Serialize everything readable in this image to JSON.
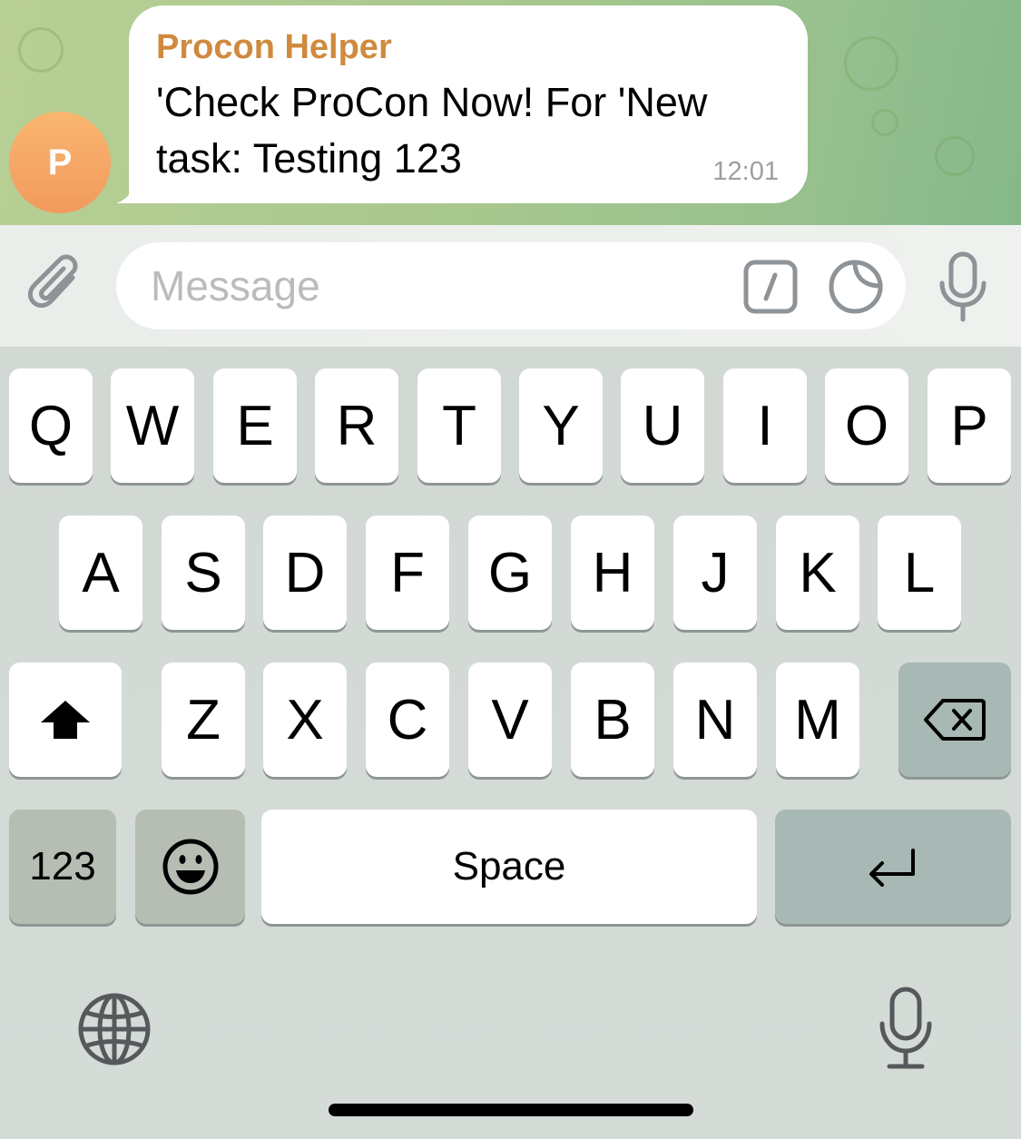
{
  "chat": {
    "avatar_letter": "P",
    "message": {
      "sender": "Procon Helper",
      "text": "'Check ProCon Now! For 'New task: Testing 123",
      "time": "12:01"
    }
  },
  "composer": {
    "placeholder": "Message",
    "icons": [
      "paperclip-icon",
      "slash-command-icon",
      "sticker-icon",
      "microphone-icon"
    ]
  },
  "keyboard": {
    "row1": [
      "Q",
      "W",
      "E",
      "R",
      "T",
      "Y",
      "U",
      "I",
      "O",
      "P"
    ],
    "row2": [
      "A",
      "S",
      "D",
      "F",
      "G",
      "H",
      "J",
      "K",
      "L"
    ],
    "row3": [
      "Z",
      "X",
      "C",
      "V",
      "B",
      "N",
      "M"
    ],
    "numbers_label": "123",
    "space_label": "Space",
    "icons": [
      "shift-icon",
      "backspace-icon",
      "emoji-icon",
      "return-icon",
      "globe-icon",
      "dictation-mic-icon"
    ]
  },
  "colors": {
    "sender_name": "#d08a3e",
    "avatar_gradient_top": "#f9b66f",
    "avatar_gradient_bottom": "#f29a5e",
    "chat_wallpaper": "#a9c88e",
    "dark_key": "#a7b8b5"
  }
}
